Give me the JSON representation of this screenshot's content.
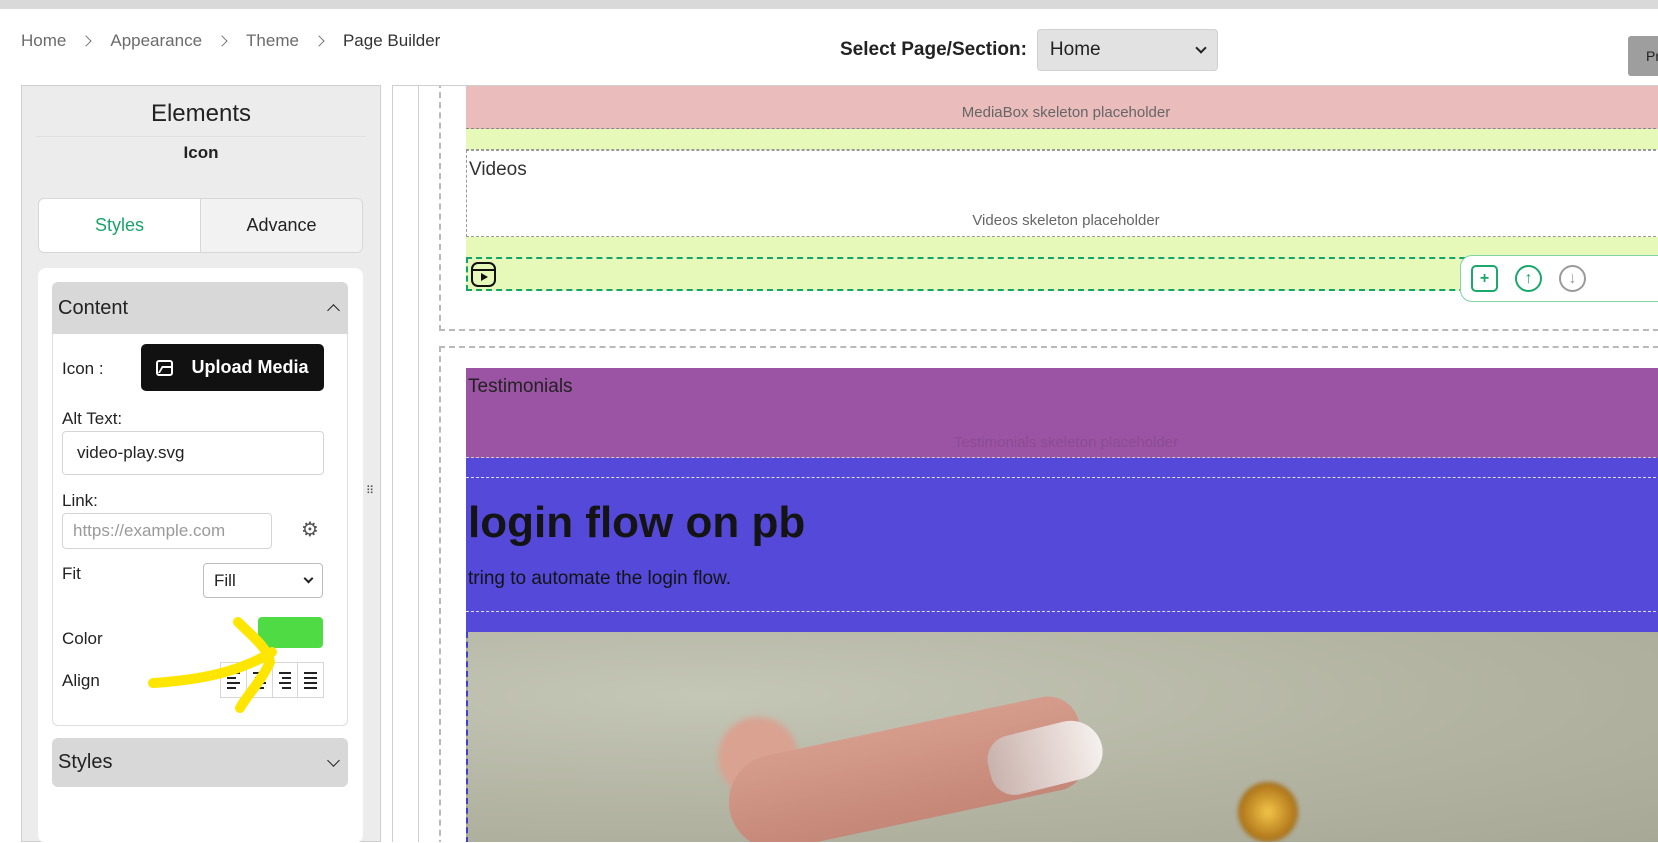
{
  "breadcrumb": [
    "Home",
    "Appearance",
    "Theme",
    "Page Builder"
  ],
  "page_select": {
    "label": "Select Page/Section:",
    "value": "Home"
  },
  "preview_button": {
    "label": "Pr"
  },
  "panel": {
    "title": "Elements",
    "subtitle": "Icon",
    "tabs": [
      {
        "label": "Styles",
        "active": true
      },
      {
        "label": "Advance",
        "active": false
      }
    ],
    "content_section": {
      "title": "Content",
      "icon_label": "Icon :",
      "upload_label": "Upload Media",
      "alt_text_label": "Alt Text:",
      "alt_text_value": "video-play.svg",
      "link_label": "Link:",
      "link_placeholder": "https://example.com",
      "fit_label": "Fit",
      "fit_value": "Fill",
      "color_label": "Color",
      "color_value": "#4fdb44",
      "align_label": "Align",
      "align_options": [
        "left",
        "center",
        "right",
        "justify"
      ]
    },
    "styles_section": {
      "title": "Styles"
    }
  },
  "canvas": {
    "mediabox_placeholder": "MediaBox skeleton placeholder",
    "videos_title": "Videos",
    "videos_placeholder": "Videos skeleton placeholder",
    "icon_element": "video-play-icon",
    "toolbar_icons": [
      "duplicate-icon",
      "move-up-icon",
      "move-down-icon"
    ],
    "testimonials_title": "Testimonials",
    "testimonials_placeholder": "Testimonials skeleton placeholder",
    "hero_title": "login flow on pb",
    "hero_text": "tring to automate the login flow."
  },
  "colors": {
    "accent": "#18a46a",
    "mediabox_bg": "#ebbcbc",
    "lime_bg": "#e6f9b9",
    "testimonials_bg": "#9b54a3",
    "hero_bg": "#5449d8",
    "highlighter": "#ffe600"
  }
}
